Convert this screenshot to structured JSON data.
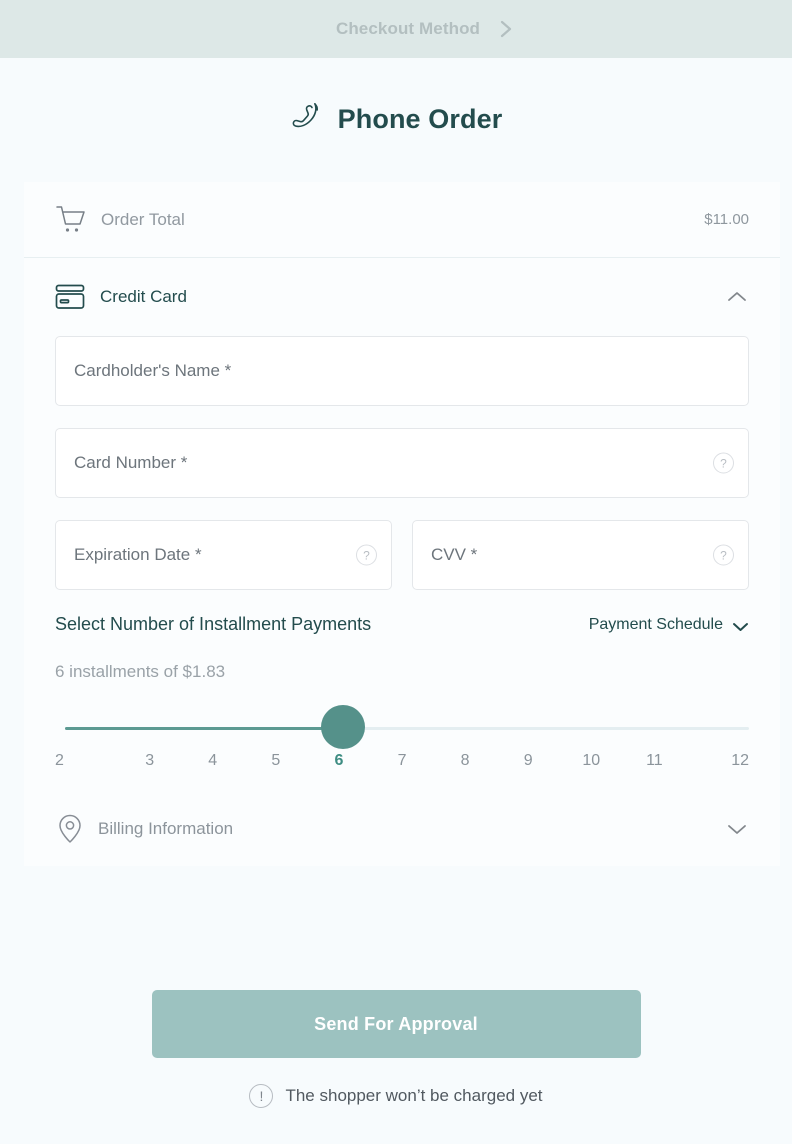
{
  "topbar": {
    "step_label": "Checkout Method",
    "next_icon": "chevron-right-icon"
  },
  "header": {
    "title": "Phone Order",
    "icon": "phone-icon"
  },
  "order_total": {
    "icon": "shopping-cart-icon",
    "label": "Order Total",
    "value": "$11.00"
  },
  "credit_card_section": {
    "icon": "credit-card-icon",
    "label": "Credit Card",
    "toggle_icon": "chevron-up-icon",
    "expanded": true
  },
  "form": {
    "cardholder_name": {
      "placeholder": "Cardholder's Name *",
      "value": ""
    },
    "card_number": {
      "placeholder": "Card Number *",
      "value": "",
      "help_icon": "question-mark-icon"
    },
    "expiration_date": {
      "placeholder": "Expiration Date *",
      "value": "",
      "help_icon": "question-mark-icon"
    },
    "cvv": {
      "placeholder": "CVV *",
      "value": "",
      "help_icon": "question-mark-icon"
    }
  },
  "installments": {
    "title": "Select Number of Installment Payments",
    "schedule_link": "Payment Schedule",
    "schedule_icon": "chevron-down-icon",
    "summary": "6 installments of $1.83",
    "selected": "6",
    "ticks": [
      "2",
      "3",
      "4",
      "5",
      "6",
      "7",
      "8",
      "9",
      "10",
      "11",
      "12"
    ]
  },
  "billing_section": {
    "icon": "location-pin-icon",
    "label": "Billing Information",
    "toggle_icon": "chevron-down-icon",
    "expanded": false
  },
  "footer": {
    "submit_label": "Send For Approval",
    "note_icon": "exclamation-circle-icon",
    "note_text": "The shopper won’t be charged yet"
  },
  "colors": {
    "topbar_bg": "#dde8e7",
    "page_bg": "#f7fbfd",
    "card_bg": "#fbfdfe",
    "accent_dark": "#234c4d",
    "accent_teal": "#55918a",
    "track_fill": "#5c9a92",
    "track_bg": "#e4eef1",
    "button_bg": "#9cc2c0",
    "muted_text": "#9199a0"
  }
}
